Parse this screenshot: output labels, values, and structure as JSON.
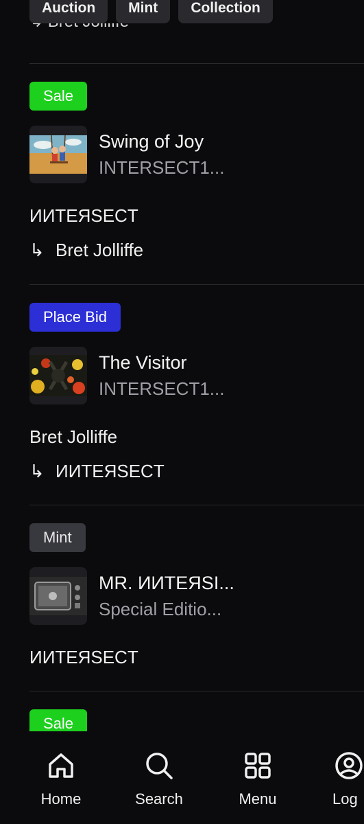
{
  "filters": {
    "auction": "Auction",
    "mint": "Mint",
    "collection": "Collection"
  },
  "cut_line_text": "↳ Bret Jolliffe",
  "cards": [
    {
      "badge": "Sale",
      "title": "Swing of Joy",
      "subtitle": "INTERSECT1...",
      "creator": "ИИТEЯSECT",
      "relay": "Bret Jolliffe",
      "relay_arrow": "↳"
    },
    {
      "badge": "Place Bid",
      "title": "The Visitor",
      "subtitle": "INTERSECT1...",
      "creator": "Bret Jolliffe",
      "relay": "ИИТEЯSECT",
      "relay_arrow": "↳"
    },
    {
      "badge": "Mint",
      "title": "MR. ИИТEЯSI...",
      "subtitle": "Special Editio...",
      "creator": "ИИТEЯSECT"
    },
    {
      "badge": "Sale"
    }
  ],
  "nav": {
    "home": "Home",
    "search": "Search",
    "menu": "Menu",
    "login": "Log"
  },
  "colors": {
    "background": "#0b0b0d",
    "sale": "#1ed01e",
    "bid": "#2c2fd6",
    "mint": "#38383f",
    "muted_text": "#a0a0a6"
  }
}
